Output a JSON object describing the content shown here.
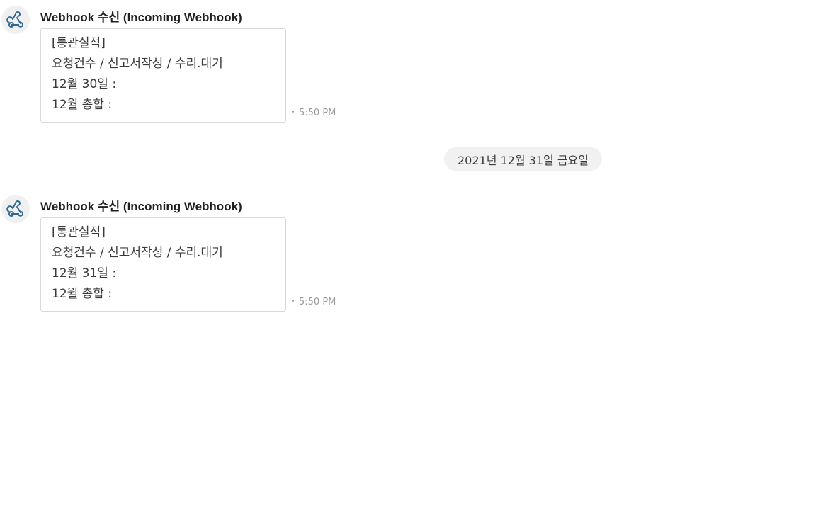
{
  "messages": [
    {
      "avatar_icon": "webhook-icon",
      "sender": "Webhook 수신 (Incoming Webhook)",
      "lines": [
        "[통관실적]",
        "요청건수 / 신고서작성 / 수리.대기",
        "12월 30일 :",
        "12월 총합 :"
      ],
      "time": "5:50 PM"
    },
    {
      "avatar_icon": "webhook-icon",
      "sender": "Webhook 수신 (Incoming Webhook)",
      "lines": [
        "[통관실적]",
        "요청건수 / 신고서작성 / 수리.대기",
        "12월 31일 :",
        "12월 총합 :"
      ],
      "time": "5:50 PM"
    }
  ],
  "date_separator": "2021년 12월 31일 금요일",
  "colors": {
    "icon_accent": "#2f6b8f",
    "bubble_border": "#d9d9d9",
    "pill_background": "#f1f1f1"
  }
}
